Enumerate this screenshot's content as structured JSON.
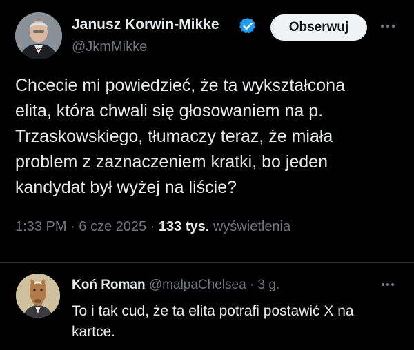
{
  "tweet": {
    "author_name": "Janusz Korwin-Mikke",
    "author_handle": "@JkmMikke",
    "follow_label": "Obserwuj",
    "more_icon": "more-horizontal-icon",
    "verified_color": "#1d9bf0",
    "text_lines": [
      "Chcecie mi powiedzieć, że ta wykształcona",
      "elita, która chwali się głosowaniem na p.",
      "Trzaskowskiego, tłumaczy teraz, że miała",
      "problem z zaznaczeniem kratki, bo jeden",
      "kandydat był wyżej na liście?"
    ],
    "time": "1:33 PM",
    "date": "6 cze 2025",
    "views_count": "133 tys.",
    "views_label": "wyświetlenia"
  },
  "reply": {
    "author_name": "Koń Roman",
    "author_handle": "@malpaChelsea",
    "age": "3 g.",
    "text_lines": [
      "To i tak cud, że ta elita potrafi postawić X na",
      "kartce."
    ]
  }
}
